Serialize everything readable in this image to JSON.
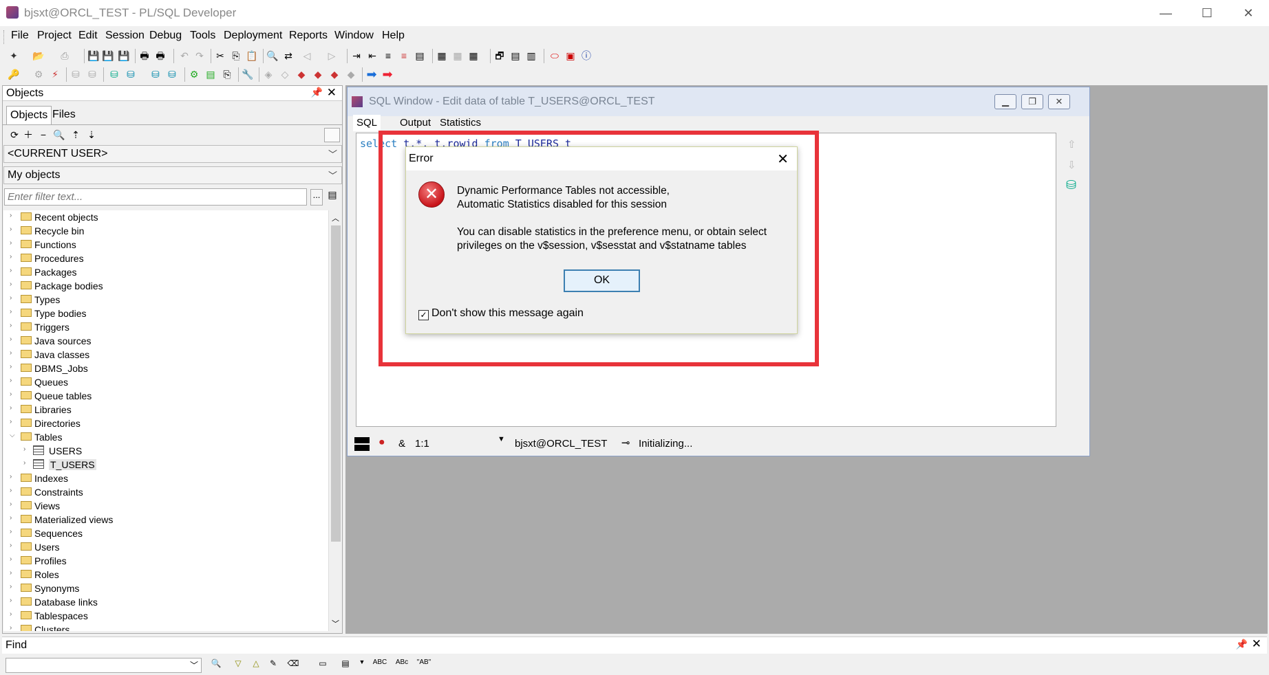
{
  "app": {
    "title": "bjsxt@ORCL_TEST - PL/SQL Developer",
    "window_controls": {
      "minimize": "—",
      "maximize": "☐",
      "close": "✕"
    }
  },
  "menu": [
    "File",
    "Project",
    "Edit",
    "Session",
    "Debug",
    "Tools",
    "Deployment",
    "Reports",
    "Window",
    "Help"
  ],
  "objects_panel": {
    "title": "Objects",
    "tabs": [
      "Objects",
      "Files"
    ],
    "user_select": "<CURRENT USER>",
    "objects_select": "My objects",
    "filter_placeholder": "Enter filter text...",
    "filter_more": "...",
    "tree": [
      {
        "label": "Recent objects",
        "expanded": false
      },
      {
        "label": "Recycle bin",
        "expanded": false
      },
      {
        "label": "Functions",
        "expanded": false
      },
      {
        "label": "Procedures",
        "expanded": false
      },
      {
        "label": "Packages",
        "expanded": false
      },
      {
        "label": "Package bodies",
        "expanded": false
      },
      {
        "label": "Types",
        "expanded": false
      },
      {
        "label": "Type bodies",
        "expanded": false
      },
      {
        "label": "Triggers",
        "expanded": false
      },
      {
        "label": "Java sources",
        "expanded": false
      },
      {
        "label": "Java classes",
        "expanded": false
      },
      {
        "label": "DBMS_Jobs",
        "expanded": false
      },
      {
        "label": "Queues",
        "expanded": false
      },
      {
        "label": "Queue tables",
        "expanded": false
      },
      {
        "label": "Libraries",
        "expanded": false
      },
      {
        "label": "Directories",
        "expanded": false
      },
      {
        "label": "Tables",
        "expanded": true
      },
      {
        "label": "USERS",
        "child": true
      },
      {
        "label": "T_USERS",
        "child": true,
        "selected": true
      },
      {
        "label": "Indexes",
        "expanded": false
      },
      {
        "label": "Constraints",
        "expanded": false
      },
      {
        "label": "Views",
        "expanded": false
      },
      {
        "label": "Materialized views",
        "expanded": false
      },
      {
        "label": "Sequences",
        "expanded": false
      },
      {
        "label": "Users",
        "expanded": false
      },
      {
        "label": "Profiles",
        "expanded": false
      },
      {
        "label": "Roles",
        "expanded": false
      },
      {
        "label": "Synonyms",
        "expanded": false
      },
      {
        "label": "Database links",
        "expanded": false
      },
      {
        "label": "Tablespaces",
        "expanded": false
      },
      {
        "label": "Clusters",
        "expanded": false
      }
    ]
  },
  "sql_window": {
    "title": "SQL Window - Edit data of table T_USERS@ORCL_TEST",
    "tabs": [
      "SQL",
      "Output",
      "Statistics"
    ],
    "code_kw1": "select",
    "code_mid": " t.*, t.rowid ",
    "code_kw2": "from",
    "code_tail": " T_USERS t",
    "status": {
      "amp": "&",
      "position": "1:1",
      "connection": "bjsxt@ORCL_TEST",
      "state": "Initializing..."
    }
  },
  "error_dialog": {
    "title": "Error",
    "line1": "Dynamic Performance Tables not accessible,",
    "line2": "Automatic Statistics disabled for this session",
    "line3": "You can disable statistics in the preference menu, or obtain select",
    "line4": "privileges on the v$session, v$sesstat and v$statname tables",
    "ok_label": "OK",
    "checkbox_label": "Don't show this message again",
    "checkbox_checked": true
  },
  "find_panel": {
    "title": "Find",
    "tool_labels": {
      "abc": "ABC",
      "abc2": "ABc",
      "ab_quoted": "\"AB\""
    }
  },
  "colors": {
    "highlight": "#e8333a",
    "keyword": "#2b7fc1",
    "identifier": "#1d2b9a"
  }
}
